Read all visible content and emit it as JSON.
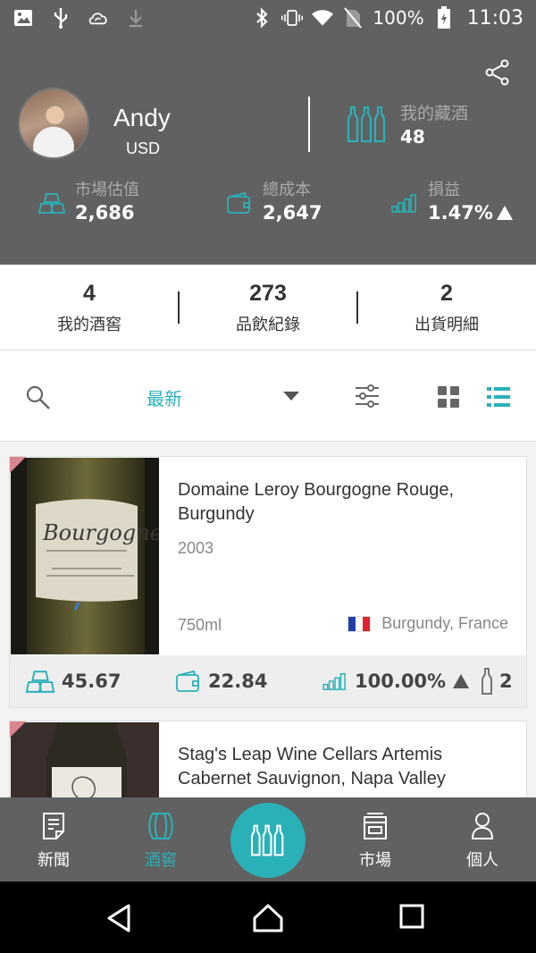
{
  "status_bar": {
    "battery": "100%",
    "time": "11:03"
  },
  "profile": {
    "name": "Andy",
    "currency": "USD"
  },
  "collection": {
    "label": "我的藏酒",
    "value": "48"
  },
  "stats": {
    "market": {
      "label": "市場估值",
      "value": "2,686"
    },
    "cost": {
      "label": "總成本",
      "value": "2,647"
    },
    "pl": {
      "label": "損益",
      "value": "1.47%"
    }
  },
  "counts": [
    {
      "number": "4",
      "label": "我的酒窖"
    },
    {
      "number": "273",
      "label": "品飲紀錄"
    },
    {
      "number": "2",
      "label": "出貨明細"
    }
  ],
  "toolbar": {
    "sort_label": "最新"
  },
  "wines": [
    {
      "name": "Domaine Leroy Bourgogne Rouge, Burgundy",
      "year": "2003",
      "volume": "750ml",
      "region": "Burgundy, France",
      "label_text": "Bourgogne",
      "market_value": "45.67",
      "cost": "22.84",
      "change": "100.00%",
      "bottles": "2"
    },
    {
      "name": "Stag's Leap Wine Cellars Artemis Cabernet Sauvignon, Napa Valley"
    }
  ],
  "nav": {
    "news": "新聞",
    "cellar": "酒窖",
    "market": "市場",
    "personal": "個人"
  },
  "colors": {
    "accent": "#2ab1b8",
    "header_bg": "#616161"
  },
  "icons": [
    "image-icon",
    "usb-icon",
    "cloud-sync-icon",
    "download-icon",
    "bluetooth-icon",
    "vibrate-icon",
    "wifi-icon",
    "no-sim-icon",
    "battery-icon",
    "share-icon",
    "bottles-icon",
    "gold-bars-icon",
    "wallet-icon",
    "signal-bars-icon",
    "search-icon",
    "filter-sliders-icon",
    "grid-view-icon",
    "list-view-icon",
    "bottle-icon",
    "news-icon",
    "barrel-icon",
    "store-icon",
    "person-icon",
    "back-icon",
    "home-icon",
    "recents-icon"
  ]
}
